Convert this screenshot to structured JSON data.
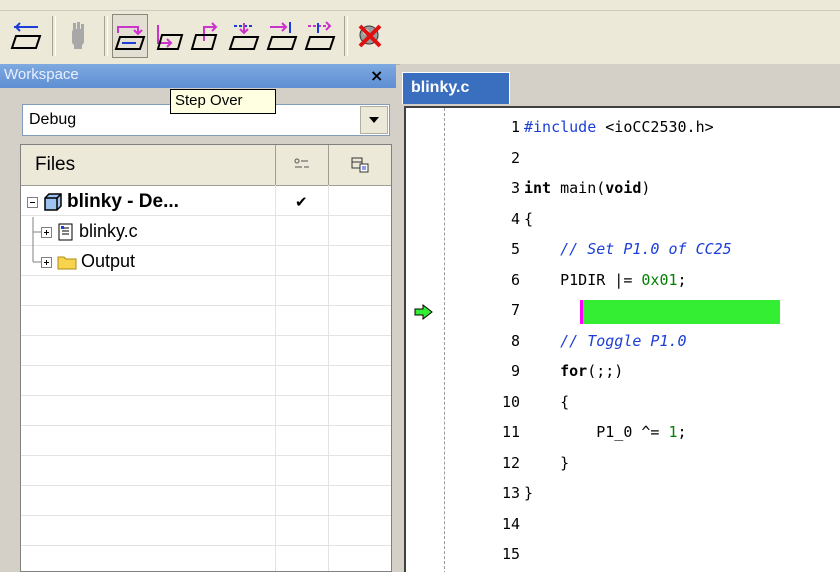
{
  "toolbar": {
    "buttons": [
      {
        "name": "step-reset-icon"
      },
      {
        "name": "break-hand-icon"
      },
      {
        "name": "step-over-icon"
      },
      {
        "name": "step-into-icon"
      },
      {
        "name": "step-out-icon"
      },
      {
        "name": "next-statement-icon"
      },
      {
        "name": "run-to-cursor-icon"
      },
      {
        "name": "go-icon"
      },
      {
        "name": "stop-debugging-icon"
      }
    ],
    "colors": {
      "accent": "#cc33cc",
      "icon_blue": "#1c3dd8"
    }
  },
  "workspace": {
    "title": "Workspace",
    "close_glyph": "×",
    "config_value": "Debug",
    "files_header": "Files",
    "tree": [
      {
        "label": "blinky - De...",
        "bold": true,
        "checked": "✔",
        "icon": "project-cube-icon"
      },
      {
        "label": "blinky.c",
        "bold": false,
        "icon": "c-file-icon"
      },
      {
        "label": "Output",
        "bold": false,
        "icon": "folder-icon"
      }
    ]
  },
  "tooltip": {
    "text": "Step Over"
  },
  "editor": {
    "tab_label": "blinky.c",
    "current_line": 6,
    "lines": [
      {
        "n": "1",
        "html": "#include <ioCC2530.h>"
      },
      {
        "n": "2",
        "html": ""
      },
      {
        "n": "3",
        "html": "int main(void)"
      },
      {
        "n": "4",
        "html": "{"
      },
      {
        "n": "5",
        "html": "    // Set P1.0 of CC25"
      },
      {
        "n": "6",
        "html": "    P1DIR |= 0x01;"
      },
      {
        "n": "7",
        "html": ""
      },
      {
        "n": "8",
        "html": "    // Toggle P1.0"
      },
      {
        "n": "9",
        "html": "    for(;;)"
      },
      {
        "n": "10",
        "html": "    {"
      },
      {
        "n": "11",
        "html": "        P1_0 ^= 1;"
      },
      {
        "n": "12",
        "html": "    }"
      },
      {
        "n": "13",
        "html": "}"
      },
      {
        "n": "14",
        "html": ""
      },
      {
        "n": "15",
        "html": ""
      }
    ]
  }
}
